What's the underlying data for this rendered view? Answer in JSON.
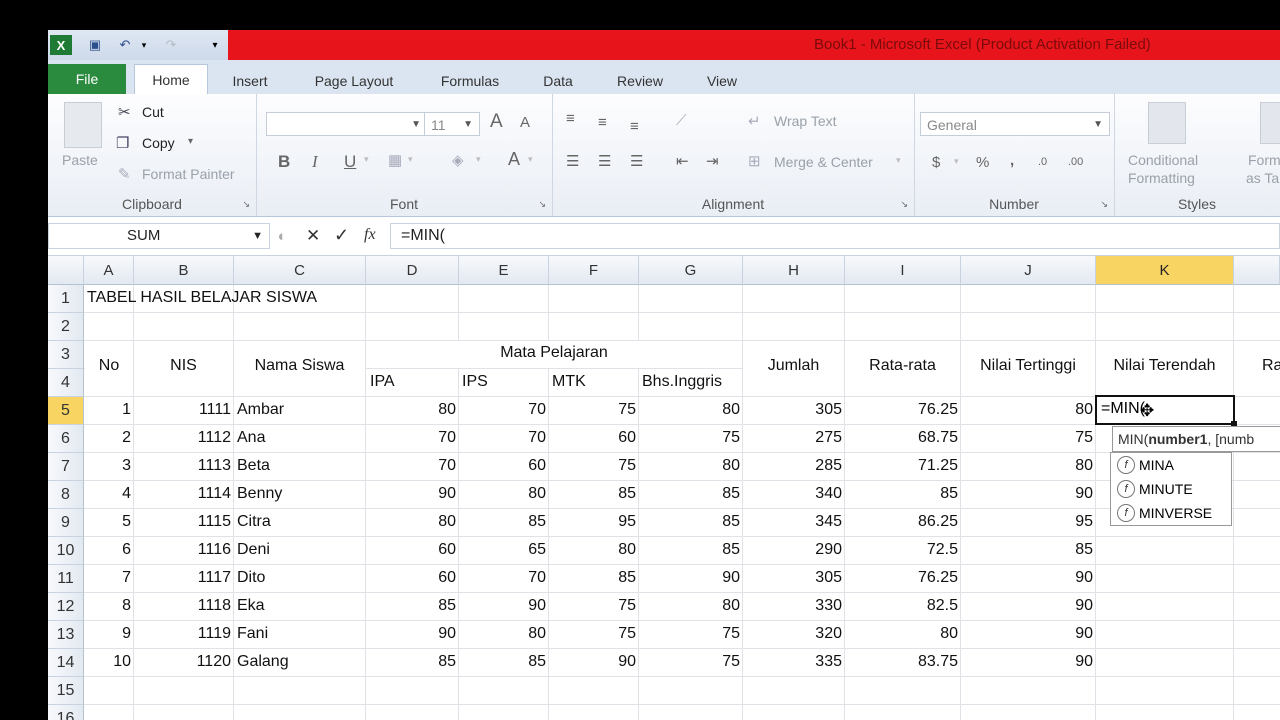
{
  "window": {
    "title": "Book1 - Microsoft Excel (Product Activation Failed)"
  },
  "tabs": [
    "File",
    "Home",
    "Insert",
    "Page Layout",
    "Formulas",
    "Data",
    "Review",
    "View"
  ],
  "active_tab": "Home",
  "ribbon": {
    "clipboard": {
      "label": "Clipboard",
      "paste": "Paste",
      "cut": "Cut",
      "copy": "Copy",
      "format_painter": "Format Painter"
    },
    "font": {
      "label": "Font",
      "font_size": "11",
      "bold": "B",
      "italic": "I",
      "underline": "U",
      "grow": "A",
      "shrink": "A"
    },
    "alignment": {
      "label": "Alignment",
      "wrap_text": "Wrap Text",
      "merge_center": "Merge & Center"
    },
    "number": {
      "label": "Number",
      "format": "General",
      "currency": "$",
      "percent": "%",
      "comma": ",",
      "inc_dec": ".0",
      "dec_dec": ".00"
    },
    "styles": {
      "label": "Styles",
      "conditional": "Conditional",
      "formatting": "Formatting",
      "format_as": "Format",
      "as_table": "as Table"
    }
  },
  "formula_bar": {
    "name_box": "SUM",
    "formula": "=MIN(",
    "cancel": "✕",
    "enter": "✓",
    "fx": "fx"
  },
  "columns": [
    "A",
    "B",
    "C",
    "D",
    "E",
    "F",
    "G",
    "H",
    "I",
    "J",
    "K"
  ],
  "selected_column": "K",
  "rows": [
    "1",
    "2",
    "3",
    "4",
    "5",
    "6",
    "7",
    "8",
    "9",
    "10",
    "11",
    "12",
    "13",
    "14",
    "15",
    "16"
  ],
  "selected_row": "5",
  "sheet": {
    "title": "TABEL HASIL BELAJAR SISWA",
    "headers": {
      "no": "No",
      "nis": "NIS",
      "nama": "Nama Siswa",
      "mapel": "Mata Pelajaran",
      "ipa": "IPA",
      "ips": "IPS",
      "mtk": "MTK",
      "bing": "Bhs.Inggris",
      "jumlah": "Jumlah",
      "rata": "Rata-rata",
      "tinggi": "Nilai Tertinggi",
      "rendah": "Nilai Terendah",
      "next": "Ra"
    },
    "data": [
      [
        "1",
        "1111",
        "Ambar",
        "80",
        "70",
        "75",
        "80",
        "305",
        "76.25",
        "80"
      ],
      [
        "2",
        "1112",
        "Ana",
        "70",
        "70",
        "60",
        "75",
        "275",
        "68.75",
        "75"
      ],
      [
        "3",
        "1113",
        "Beta",
        "70",
        "60",
        "75",
        "80",
        "285",
        "71.25",
        "80"
      ],
      [
        "4",
        "1114",
        "Benny",
        "90",
        "80",
        "85",
        "85",
        "340",
        "85",
        "90"
      ],
      [
        "5",
        "1115",
        "Citra",
        "80",
        "85",
        "95",
        "85",
        "345",
        "86.25",
        "95"
      ],
      [
        "6",
        "1116",
        "Deni",
        "60",
        "65",
        "80",
        "85",
        "290",
        "72.5",
        "85"
      ],
      [
        "7",
        "1117",
        "Dito",
        "60",
        "70",
        "85",
        "90",
        "305",
        "76.25",
        "90"
      ],
      [
        "8",
        "1118",
        "Eka",
        "85",
        "90",
        "75",
        "80",
        "330",
        "82.5",
        "90"
      ],
      [
        "9",
        "1119",
        "Fani",
        "90",
        "80",
        "75",
        "75",
        "320",
        "80",
        "90"
      ],
      [
        "10",
        "1120",
        "Galang",
        "85",
        "85",
        "90",
        "75",
        "335",
        "83.75",
        "90"
      ]
    ],
    "editing_cell": "=MIN("
  },
  "tooltip": {
    "fn": "MIN(",
    "arg": "number1",
    "rest": ", [numb"
  },
  "autocomplete": [
    "MINA",
    "MINUTE",
    "MINVERSE"
  ],
  "colors": {
    "title_red": "#e8141c",
    "file_tab": "#2a8a3e",
    "selected_header": "#f8d563"
  }
}
